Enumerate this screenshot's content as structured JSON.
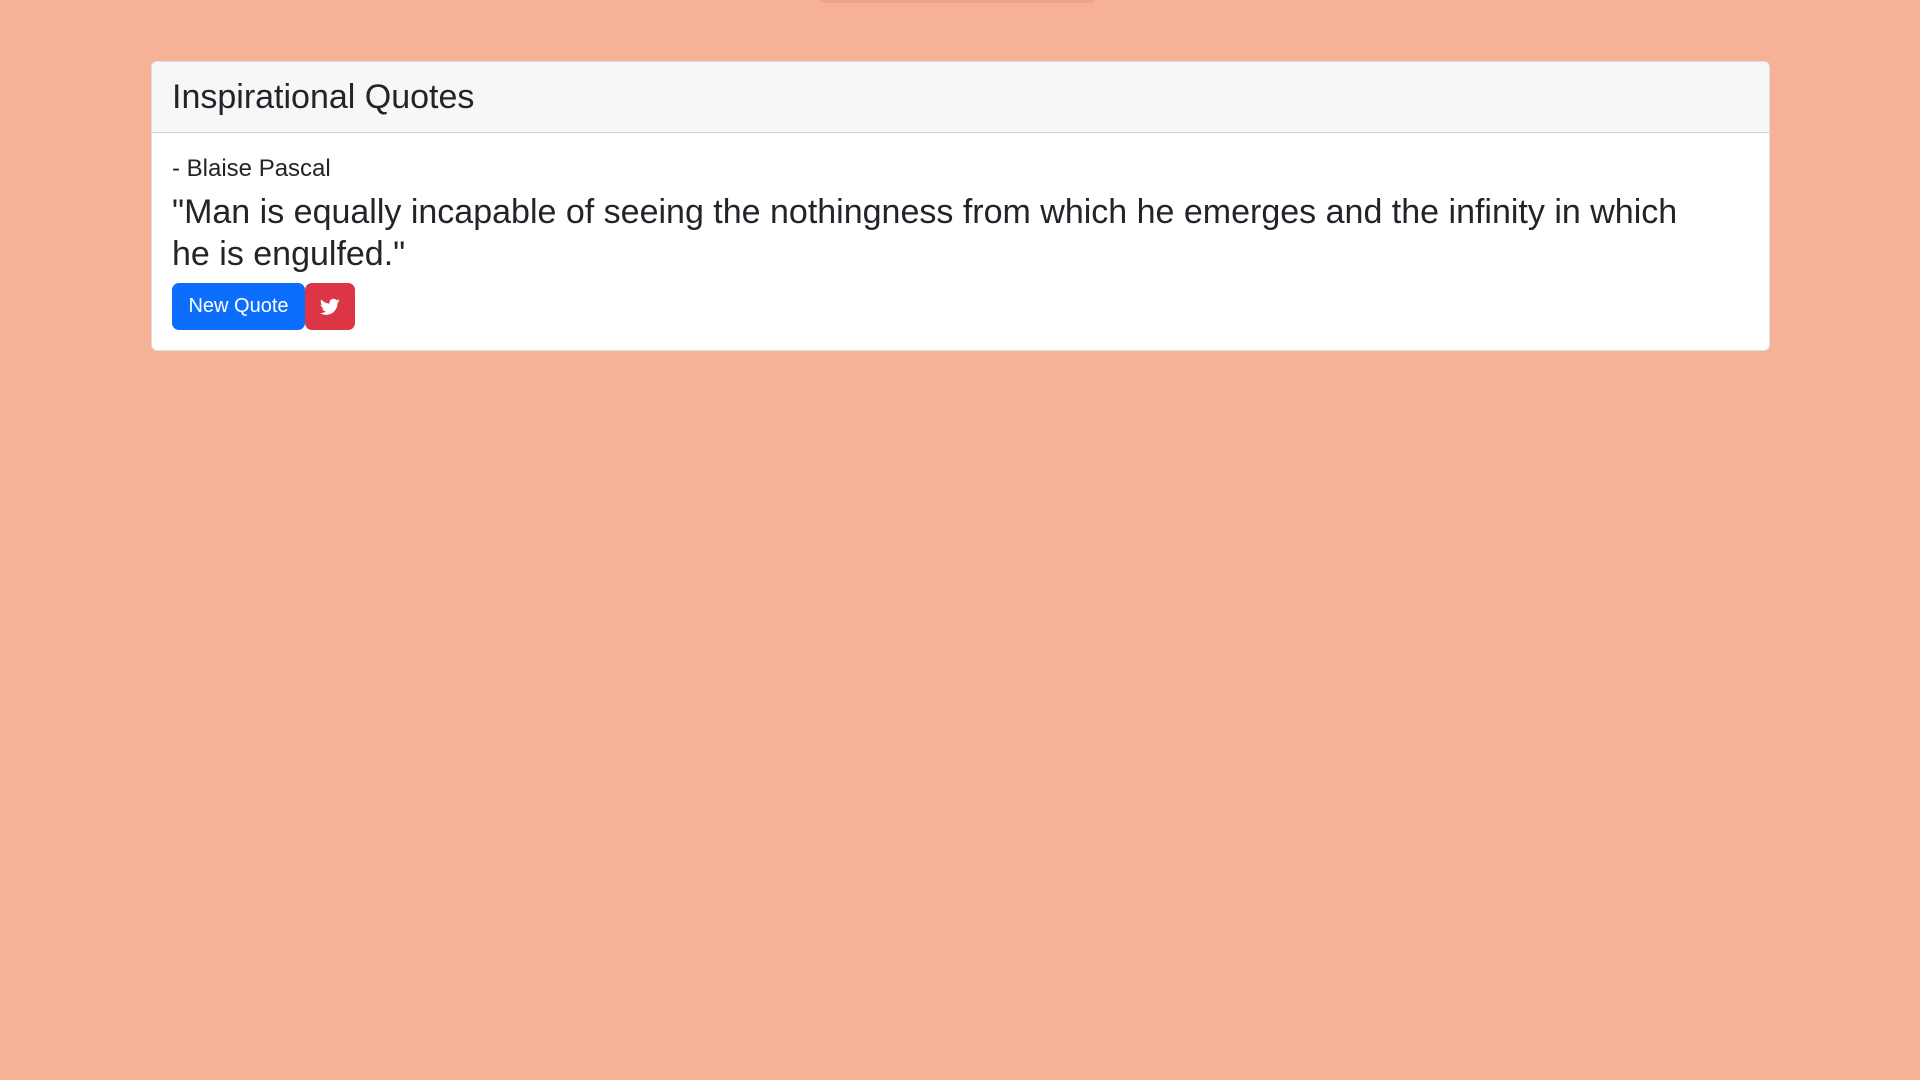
{
  "header": {
    "title": "Inspirational Quotes"
  },
  "quote": {
    "author": "- Blaise Pascal",
    "text": "\"Man is equally incapable of seeing the nothingness from which he emerges and the infinity in which he is engulfed.\""
  },
  "actions": {
    "new_quote_label": "New Quote",
    "tweet_icon": "twitter-icon"
  },
  "colors": {
    "background": "#f7b196",
    "primary": "#0d6efd",
    "danger": "#dc3545"
  }
}
